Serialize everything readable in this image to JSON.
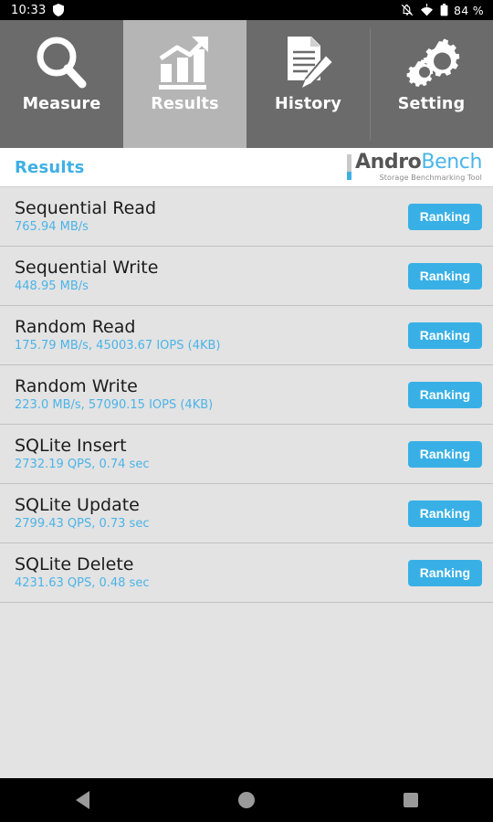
{
  "status_bar": {
    "time": "10:33",
    "shield_icon": "shield-icon",
    "mute_icon": "bell-off-icon",
    "wifi_icon": "wifi-icon",
    "battery_icon": "battery-icon",
    "battery_text": "84 %"
  },
  "tabs": [
    {
      "label": "Measure",
      "icon": "magnifier-icon",
      "selected": false
    },
    {
      "label": "Results",
      "icon": "bar-chart-arrow-icon",
      "selected": true
    },
    {
      "label": "History",
      "icon": "document-pencil-icon",
      "selected": false
    },
    {
      "label": "Setting",
      "icon": "gears-icon",
      "selected": false
    }
  ],
  "header": {
    "title": "Results",
    "brand_primary": "Andro",
    "brand_secondary": "Bench",
    "brand_tagline": "Storage Benchmarking Tool"
  },
  "results": [
    {
      "title": "Sequential Read",
      "value": "765.94 MB/s",
      "button": "Ranking"
    },
    {
      "title": "Sequential Write",
      "value": "448.95 MB/s",
      "button": "Ranking"
    },
    {
      "title": "Random Read",
      "value": "175.79 MB/s, 45003.67 IOPS (4KB)",
      "button": "Ranking"
    },
    {
      "title": "Random Write",
      "value": "223.0 MB/s, 57090.15 IOPS (4KB)",
      "button": "Ranking"
    },
    {
      "title": "SQLite Insert",
      "value": "2732.19 QPS, 0.74 sec",
      "button": "Ranking"
    },
    {
      "title": "SQLite Update",
      "value": "2799.43 QPS, 0.73 sec",
      "button": "Ranking"
    },
    {
      "title": "SQLite Delete",
      "value": "4231.63 QPS, 0.48 sec",
      "button": "Ranking"
    }
  ],
  "navigation_bar": {
    "back": "back-icon",
    "home": "home-icon",
    "recents": "recents-icon"
  },
  "colors": {
    "accent_blue": "#3fb0e5",
    "tab_unselected": "#6b6b6b",
    "tab_selected": "#b5b5b5",
    "list_bg": "#e3e3e3",
    "row_title": "#1c1c1c"
  }
}
